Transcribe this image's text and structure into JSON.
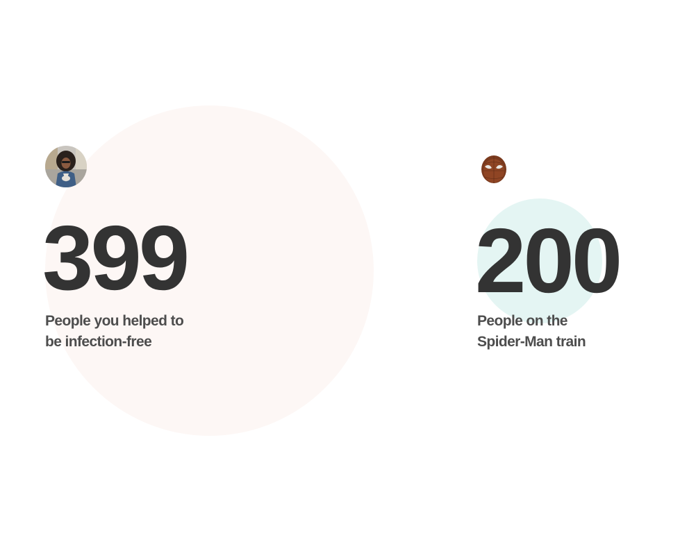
{
  "colors": {
    "text_primary": "#333333",
    "text_secondary": "#4d4d4d",
    "left_bubble": "#fdf7f5",
    "right_bubble": "#e4f5f3"
  },
  "stats": [
    {
      "avatar_icon": "woman-portrait-icon",
      "value": "399",
      "label_line1": "People you helped to",
      "label_line2": "be infection-free"
    },
    {
      "avatar_icon": "spider-man-mask-icon",
      "value": "200",
      "label_line1": "People on the",
      "label_line2": "Spider-Man train"
    }
  ]
}
